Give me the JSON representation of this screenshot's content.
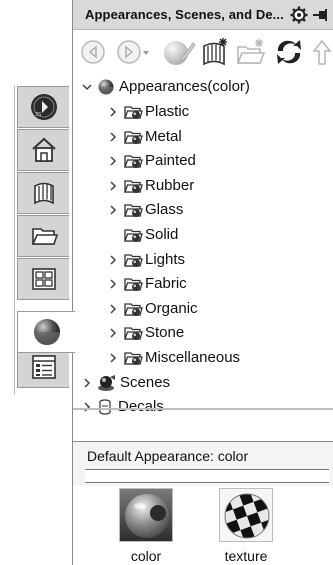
{
  "pane": {
    "title": "Appearances, Scenes, and De..."
  },
  "toolbar": {
    "buttons": [
      "back-icon",
      "forward-dropdown-icon",
      "edit-appearance-icon",
      "add-library-icon",
      "open-folder-icon",
      "refresh-icon",
      "up-icon"
    ]
  },
  "tree": {
    "root": "Appearances(color)",
    "items": [
      {
        "label": "Plastic",
        "expandable": true
      },
      {
        "label": "Metal",
        "expandable": true
      },
      {
        "label": "Painted",
        "expandable": true
      },
      {
        "label": "Rubber",
        "expandable": true
      },
      {
        "label": "Glass",
        "expandable": true
      },
      {
        "label": "Solid",
        "expandable": false
      },
      {
        "label": "Lights",
        "expandable": true
      },
      {
        "label": "Fabric",
        "expandable": true
      },
      {
        "label": "Organic",
        "expandable": true
      },
      {
        "label": "Stone",
        "expandable": true
      },
      {
        "label": "Miscellaneous",
        "expandable": true
      }
    ],
    "scenes": "Scenes",
    "decals": "Decals"
  },
  "default_appearance": {
    "label": "Default Appearance: color"
  },
  "thumbnails": [
    {
      "caption": "color"
    },
    {
      "caption": "texture"
    }
  ],
  "tabs": [
    "solidworks-resources-icon",
    "design-library-icon",
    "file-explorer-icon",
    "open-folder-icon",
    "view-palette-icon",
    "appearances-icon",
    "custom-properties-icon"
  ],
  "colors": {
    "titlebar_bg": "#d9d9d9",
    "tab_bg": "#d4d4d4",
    "pane_bg": "#ffffff"
  }
}
